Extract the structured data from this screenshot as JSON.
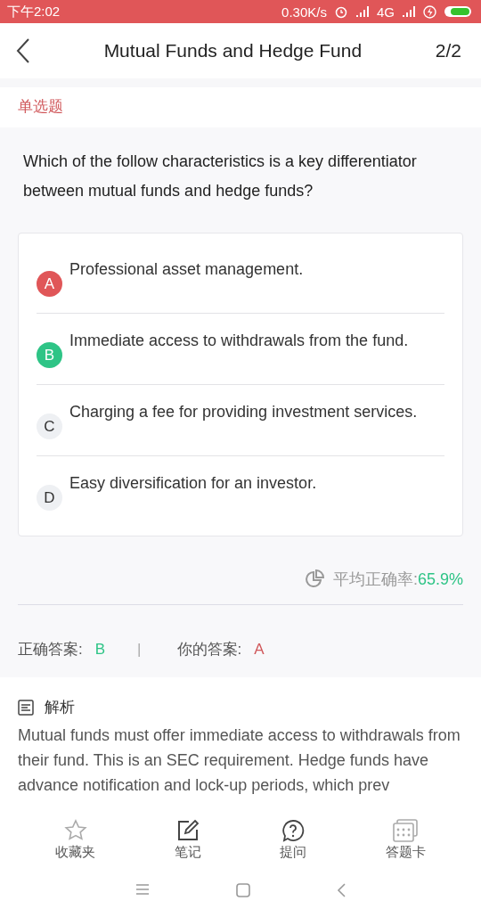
{
  "status_bar": {
    "time": "下午2:02",
    "speed": "0.30K/s",
    "network": "4G"
  },
  "header": {
    "title": "Mutual Funds and Hedge Fund",
    "progress": "2/2"
  },
  "question_type": "单选题",
  "question": "Which of the follow characteristics is a key differentiator between mutual funds and hedge funds?",
  "options": [
    {
      "letter": "A",
      "text": "Professional asset management.",
      "correct": false,
      "chosen": true
    },
    {
      "letter": "B",
      "text": "Immediate access to withdrawals from the fund.",
      "correct": true,
      "chosen": false
    },
    {
      "letter": "C",
      "text": "Charging a fee for providing investment services.",
      "correct": false,
      "chosen": false
    },
    {
      "letter": "D",
      "text": "Easy diversification for an investor.",
      "correct": false,
      "chosen": false
    }
  ],
  "stats": {
    "label": "平均正确率:",
    "value": "65.9%"
  },
  "answers": {
    "correct_label": "正确答案:",
    "correct": "B",
    "separator": "|",
    "yours_label": "你的答案:",
    "yours": "A"
  },
  "analysis": {
    "title": "解析",
    "text": "Mutual funds must offer immediate access to withdrawals from their fund. This is an SEC requirement. Hedge funds have advance notification and lock-up periods, which prev"
  },
  "tab_bar": [
    {
      "kind": "star",
      "label": "收藏夹"
    },
    {
      "kind": "note",
      "label": "笔记"
    },
    {
      "kind": "ask",
      "label": "提问"
    },
    {
      "kind": "card",
      "label": "答题卡"
    }
  ]
}
